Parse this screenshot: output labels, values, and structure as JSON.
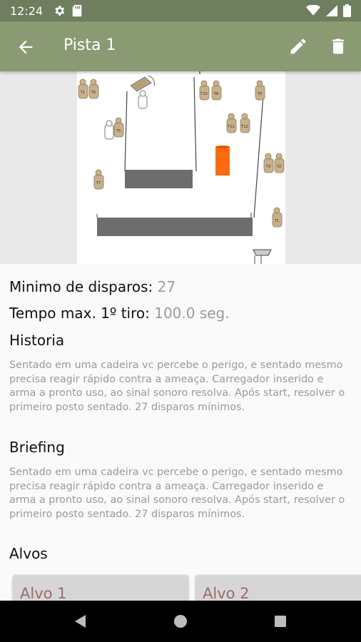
{
  "status_bar": {
    "time": "12:24",
    "icons": [
      "gear-icon",
      "sd-card-icon",
      "wifi-icon",
      "signal-icon",
      "battery-icon"
    ]
  },
  "app_bar": {
    "title": "Pista 1",
    "icons": [
      "back-arrow-icon",
      "pencil-icon",
      "trash-icon"
    ],
    "color": "#8a9a72"
  },
  "stage": {
    "target_labels": [
      "T1",
      "T6",
      "T10",
      "T8",
      "T8",
      "T11",
      "T12",
      "T5",
      "T7",
      "T3",
      "T2",
      "T1"
    ]
  },
  "details": {
    "min_shots_label": "Minimo de disparos:",
    "min_shots_value": "27",
    "max_time_label": "Tempo max. 1º tiro:",
    "max_time_value": "100.0 seg."
  },
  "historia": {
    "title": "Historia",
    "text": "Sentado em uma cadeira vc percebe o perigo, e sentado mesmo precisa reagir rápido contra a ameaça. Carregador inserido e arma a pronto uso, ao sinal sonoro resolva. Após start, resolver o primeiro posto sentado. 27 disparos mínimos."
  },
  "briefing": {
    "title": "Briefing",
    "text": "Sentado em uma cadeira vc percebe o perigo, e sentado mesmo precisa reagir rápido contra a ameaça. Carregador inserido e arma a pronto uso, ao sinal sonoro resolva. Após start, resolver o primeiro posto sentado. 27 disparos mínimos."
  },
  "alvos": {
    "title": "Alvos",
    "items": [
      "Alvo 1",
      "Alvo 2"
    ]
  },
  "nav_bar": {
    "icons": [
      "back-triangle-icon",
      "home-circle-icon",
      "recents-square-icon"
    ]
  }
}
